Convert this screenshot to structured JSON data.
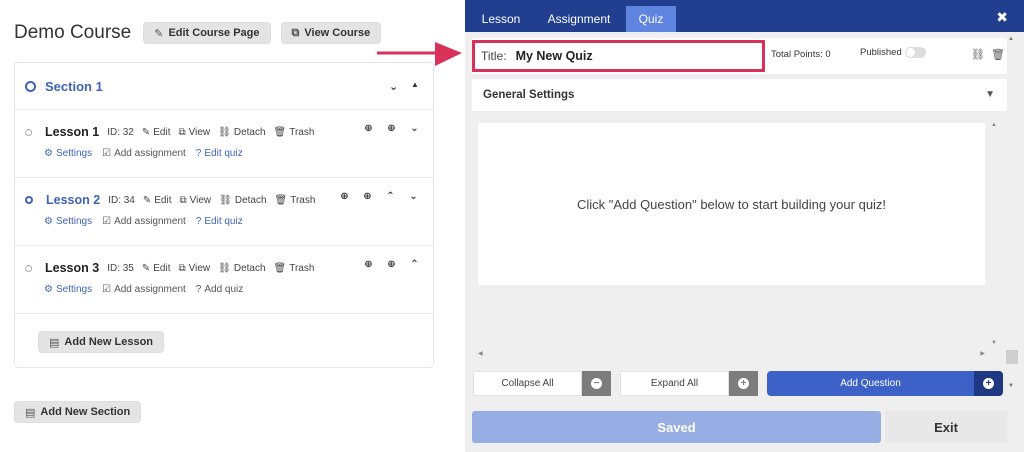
{
  "course": {
    "title": "Demo Course",
    "edit_page_label": "Edit Course Page",
    "view_course_label": "View Course",
    "add_section_label": "Add New Section"
  },
  "section": {
    "label": "Section 1",
    "add_lesson_label": "Add New Lesson"
  },
  "lessons": [
    {
      "name": "Lesson 1",
      "id": "ID: 32",
      "edit": "Edit",
      "view": "View",
      "detach": "Detach",
      "trash": "Trash",
      "settings": "Settings",
      "assignment": "Add assignment",
      "quiz": "Edit quiz"
    },
    {
      "name": "Lesson 2",
      "id": "ID: 34",
      "edit": "Edit",
      "view": "View",
      "detach": "Detach",
      "trash": "Trash",
      "settings": "Settings",
      "assignment": "Add assignment",
      "quiz": "Edit quiz"
    },
    {
      "name": "Lesson 3",
      "id": "ID: 35",
      "edit": "Edit",
      "view": "View",
      "detach": "Detach",
      "trash": "Trash",
      "settings": "Settings",
      "assignment": "Add assignment",
      "quiz": "Add quiz"
    }
  ],
  "panel": {
    "tabs": [
      "Lesson",
      "Assignment",
      "Quiz"
    ],
    "active_tab": "Quiz",
    "close_symbol": "✖",
    "title_label": "Title:",
    "title_value": "My New Quiz",
    "total_points": "Total Points: 0",
    "published_label": "Published",
    "general_settings": "General Settings",
    "empty_message": "Click \"Add Question\" below to start building your quiz!",
    "collapse_all": "Collapse All",
    "expand_all": "Expand All",
    "add_question": "Add Question",
    "saved": "Saved",
    "exit": "Exit"
  },
  "colors": {
    "tabbar": "#223e8e",
    "active_tab": "#5f84e0",
    "accent_blue": "#3f63b5",
    "highlight": "#d9325a",
    "saved_btn": "#97aee4"
  }
}
